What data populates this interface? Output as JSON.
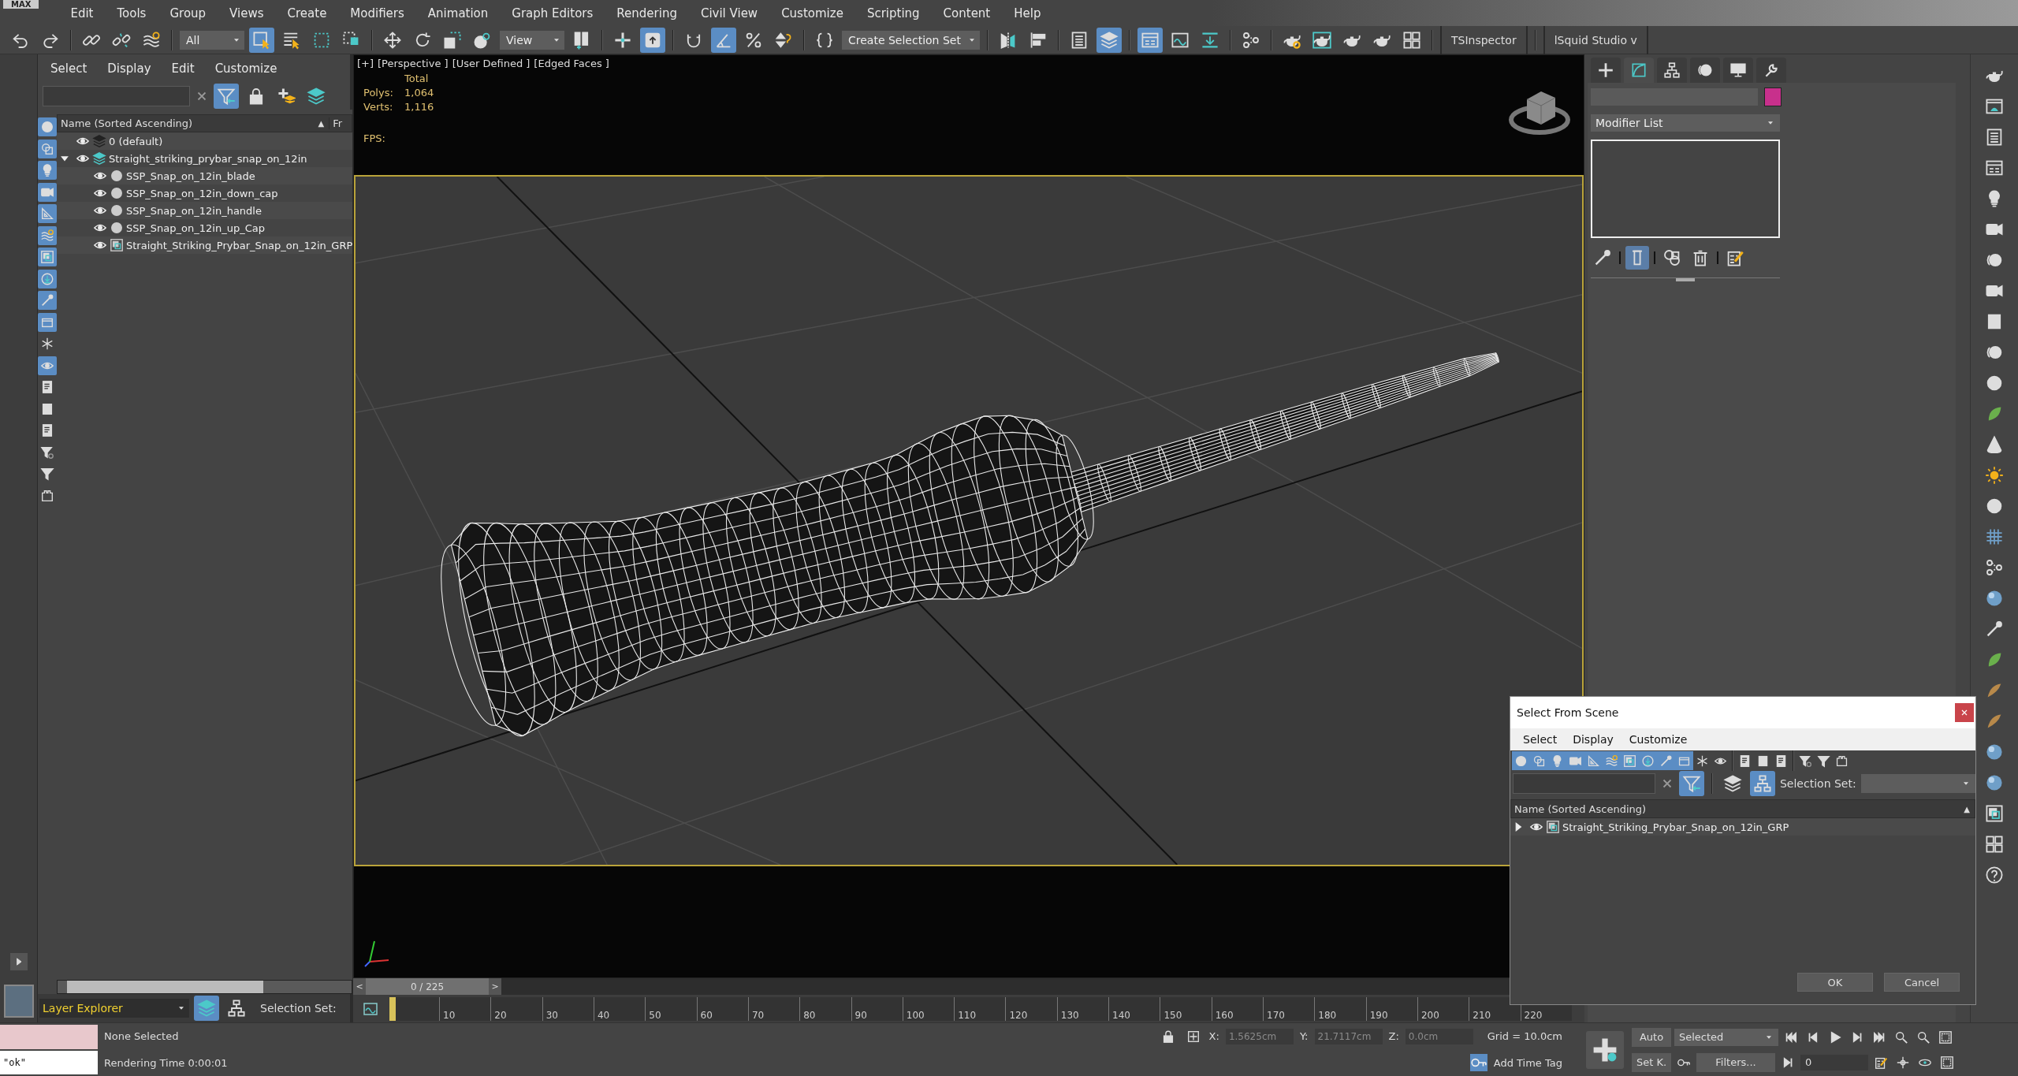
{
  "app_logo": "MAX",
  "menu": [
    "Edit",
    "Tools",
    "Group",
    "Views",
    "Create",
    "Modifiers",
    "Animation",
    "Graph Editors",
    "Rendering",
    "Civil View",
    "Customize",
    "Scripting",
    "Content",
    "Help"
  ],
  "main_toolbar": [
    {
      "kind": "button",
      "on": false
    },
    {
      "kind": "button",
      "on": false
    },
    {
      "kind": "separator"
    },
    {
      "kind": "button",
      "on": false
    },
    {
      "kind": "button",
      "on": false
    },
    {
      "kind": "button",
      "on": false
    },
    {
      "kind": "separator"
    },
    {
      "kind": "dropdown",
      "value": "All"
    },
    {
      "kind": "button",
      "on": true
    },
    {
      "kind": "button",
      "on": false
    },
    {
      "kind": "button",
      "on": false
    },
    {
      "kind": "button",
      "on": false
    },
    {
      "kind": "separator"
    },
    {
      "kind": "button",
      "on": false
    },
    {
      "kind": "button",
      "on": false
    },
    {
      "kind": "button",
      "on": false
    },
    {
      "kind": "button",
      "on": false
    },
    {
      "kind": "dropdown",
      "value": "View"
    },
    {
      "kind": "button",
      "on": false
    },
    {
      "kind": "separator"
    },
    {
      "kind": "button",
      "on": false
    },
    {
      "kind": "button",
      "on": true
    },
    {
      "kind": "separator"
    },
    {
      "kind": "button",
      "on": false
    },
    {
      "kind": "button",
      "on": true
    },
    {
      "kind": "button",
      "on": false
    },
    {
      "kind": "button",
      "on": false
    },
    {
      "kind": "separator"
    },
    {
      "kind": "button",
      "on": false
    },
    {
      "kind": "dropdown",
      "value": "Create Selection Set"
    },
    {
      "kind": "separator"
    },
    {
      "kind": "button",
      "on": false
    },
    {
      "kind": "button",
      "on": false
    },
    {
      "kind": "separator"
    },
    {
      "kind": "button",
      "on": false
    },
    {
      "kind": "button",
      "on": true
    },
    {
      "kind": "separator"
    },
    {
      "kind": "button",
      "on": true
    },
    {
      "kind": "button",
      "on": false
    },
    {
      "kind": "button",
      "on": false
    },
    {
      "kind": "separator"
    },
    {
      "kind": "button",
      "on": false
    },
    {
      "kind": "separator"
    },
    {
      "kind": "button",
      "on": false
    },
    {
      "kind": "button",
      "on": false
    },
    {
      "kind": "button",
      "on": false
    },
    {
      "kind": "button",
      "on": false
    },
    {
      "kind": "button",
      "on": false
    },
    {
      "kind": "separator"
    },
    {
      "kind": "label",
      "value": "TSInspector"
    },
    {
      "kind": "separator"
    },
    {
      "kind": "label",
      "value": "lSquid Studio v"
    }
  ],
  "scene_explorer": {
    "menu": [
      "Select",
      "Display",
      "Edit",
      "Customize"
    ],
    "search_filter_on": true,
    "filters": [
      {
        "on": true
      },
      {
        "on": true
      },
      {
        "on": true
      },
      {
        "on": true
      },
      {
        "on": true
      },
      {
        "on": true
      },
      {
        "on": true
      },
      {
        "on": true
      },
      {
        "on": true
      },
      {
        "on": true
      },
      {
        "on": false
      },
      {
        "on": true
      },
      {
        "on": false
      },
      {
        "on": false
      },
      {
        "on": false
      },
      {
        "on": false
      },
      {
        "on": false
      },
      {
        "on": false
      }
    ],
    "column_header": "Name (Sorted Ascending)",
    "sort_arrow": "▲",
    "column_2": "Fr",
    "tree": [
      {
        "kind": "layer",
        "label": "0 (default)",
        "current": false
      },
      {
        "kind": "layer",
        "label": "Straight_striking_prybar_snap_on_12in",
        "current": true,
        "expanded": true,
        "children": [
          {
            "kind": "object",
            "label": "SSP_Snap_on_12in_blade"
          },
          {
            "kind": "object",
            "label": "SSP_Snap_on_12in_down_cap"
          },
          {
            "kind": "object",
            "label": "SSP_Snap_on_12in_handle"
          },
          {
            "kind": "object",
            "label": "SSP_Snap_on_12in_up_Cap"
          },
          {
            "kind": "group",
            "label": "Straight_Striking_Prybar_Snap_on_12in_GRP"
          }
        ]
      }
    ],
    "explorer_type": "Layer Explorer",
    "selection_set_label": "Selection Set:"
  },
  "viewport": {
    "labels": [
      "[+]",
      "[Perspective ]",
      "[User Defined ]",
      "[Edged Faces ]"
    ],
    "stats_heading": "Total",
    "stats": [
      {
        "label": "Polys:",
        "value": "1,064"
      },
      {
        "label": "Verts:",
        "value": "1,116"
      }
    ],
    "fps_label": "FPS:"
  },
  "command_panel": {
    "tabs": [
      {
        "selected": false
      },
      {
        "selected": true
      },
      {
        "selected": false
      },
      {
        "selected": false
      },
      {
        "selected": false
      },
      {
        "selected": false
      }
    ],
    "modifier_list": "Modifier List",
    "stack_buttons": [
      {
        "on": false
      },
      {
        "on": true
      },
      {
        "on": false
      },
      {
        "on": false
      },
      {
        "on": false
      }
    ]
  },
  "dialog": {
    "title": "Select From Scene",
    "menu": [
      "Select",
      "Display",
      "Customize"
    ],
    "filters": [
      {
        "on": true
      },
      {
        "on": true
      },
      {
        "on": true
      },
      {
        "on": true
      },
      {
        "on": true
      },
      {
        "on": true
      },
      {
        "on": true
      },
      {
        "on": true
      },
      {
        "on": true
      },
      {
        "on": true
      },
      {
        "on": false
      },
      {
        "on": false
      },
      {
        "on": false
      },
      {
        "on": false
      },
      {
        "on": false
      },
      {
        "on": false
      },
      {
        "on": false
      },
      {
        "on": false
      }
    ],
    "search_filter_on": true,
    "hierarchy_on": true,
    "selection_set_label": "Selection Set:",
    "column_header": "Name (Sorted Ascending)",
    "sort_arrow": "▲",
    "tree": [
      {
        "kind": "group",
        "label": "Straight_Striking_Prybar_Snap_on_12in_GRP",
        "expanded": false
      }
    ],
    "buttons": [
      "OK",
      "Cancel"
    ]
  },
  "timeline": {
    "prev": "<",
    "position": "0 / 225",
    "level": 0,
    "next": ">",
    "ticks": [
      "10",
      "20",
      "30",
      "40",
      "50",
      "60",
      "70",
      "80",
      "90",
      "100",
      "110",
      "120",
      "130",
      "140",
      "150",
      "160",
      "170",
      "180",
      "190",
      "200",
      "210",
      "220"
    ]
  },
  "status": {
    "listener_output": "\"ok\"",
    "selection": "None Selected",
    "render_time": "Rendering Time  0:00:01",
    "coords": [
      {
        "label": "X:",
        "value": "1.5625cm",
        "disabled": true
      },
      {
        "label": "Y:",
        "value": "21.7117cm",
        "disabled": true
      },
      {
        "label": "Z:",
        "value": "0.0cm",
        "disabled": true
      }
    ],
    "grid": "Grid = 10.0cm",
    "time_tag": "Add Time Tag",
    "auto_key": "Auto",
    "set_key": "Set K.",
    "key_mode": "Selected",
    "filters": "Filters...",
    "frame": "0"
  }
}
